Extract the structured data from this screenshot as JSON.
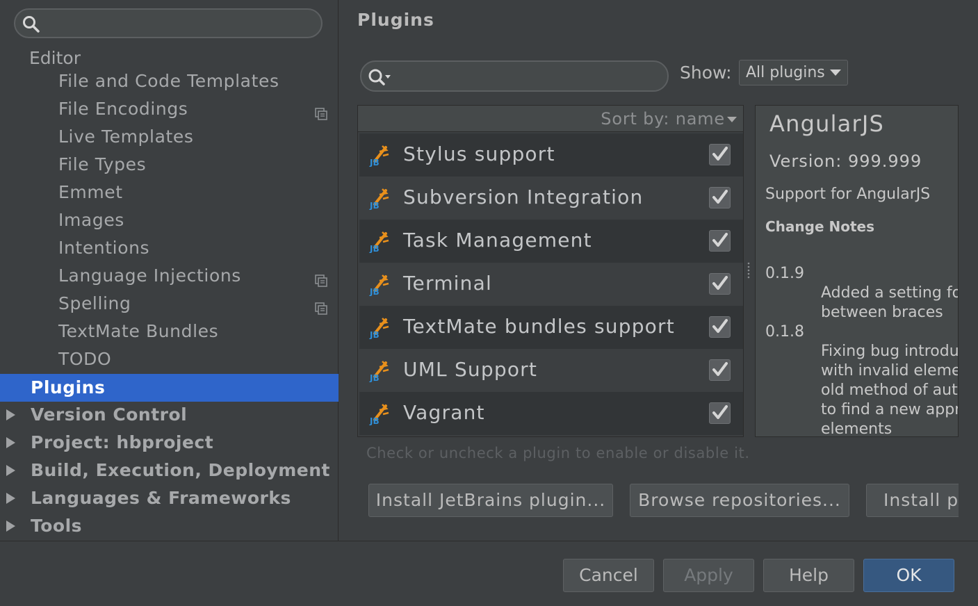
{
  "sidebar": {
    "search": {
      "icon": "search-icon",
      "value": ""
    },
    "items": [
      {
        "label": "Editor",
        "kind": "header"
      },
      {
        "label": "File and Code Templates",
        "kind": "child"
      },
      {
        "label": "File Encodings",
        "kind": "child",
        "icon": "project-scope-icon"
      },
      {
        "label": "Live Templates",
        "kind": "child"
      },
      {
        "label": "File Types",
        "kind": "child"
      },
      {
        "label": "Emmet",
        "kind": "child"
      },
      {
        "label": "Images",
        "kind": "child"
      },
      {
        "label": "Intentions",
        "kind": "child"
      },
      {
        "label": "Language Injections",
        "kind": "child",
        "icon": "project-scope-icon"
      },
      {
        "label": "Spelling",
        "kind": "child",
        "icon": "project-scope-icon"
      },
      {
        "label": "TextMate Bundles",
        "kind": "child"
      },
      {
        "label": "TODO",
        "kind": "child"
      },
      {
        "label": "Plugins",
        "kind": "top",
        "selected": true
      },
      {
        "label": "Version Control",
        "kind": "top",
        "expandable": true
      },
      {
        "label": "Project: hbproject",
        "kind": "top",
        "expandable": true
      },
      {
        "label": "Build, Execution, Deployment",
        "kind": "top",
        "expandable": true
      },
      {
        "label": "Languages & Frameworks",
        "kind": "top",
        "expandable": true
      },
      {
        "label": "Tools",
        "kind": "top",
        "expandable": true
      }
    ]
  },
  "main": {
    "title": "Plugins",
    "search": {
      "icon": "search-with-options-icon",
      "value": ""
    },
    "show_label": "Show:",
    "show_selected": "All plugins",
    "sort_label": "Sort by: name",
    "plugins": [
      {
        "name": "Stylus support",
        "enabled": true
      },
      {
        "name": "Subversion Integration",
        "enabled": true
      },
      {
        "name": "Task Management",
        "enabled": true
      },
      {
        "name": "Terminal",
        "enabled": true
      },
      {
        "name": "TextMate bundles support",
        "enabled": true
      },
      {
        "name": "UML Support",
        "enabled": true
      },
      {
        "name": "Vagrant",
        "enabled": true
      }
    ],
    "detail": {
      "name": "AngularJS",
      "version": "Version: 999.999",
      "description": "Support for AngularJS",
      "change_notes_heading": "Change Notes",
      "change_notes": [
        {
          "version": "0.1.9",
          "lines": [
            "Added a setting fo",
            "between braces"
          ]
        },
        {
          "version": "0.1.8",
          "lines": [
            "Fixing bug introdu",
            "with invalid elemer",
            "old method of autc",
            "to find a new appro",
            "elements"
          ]
        }
      ]
    },
    "hint": "Check or uncheck a plugin to enable or disable it.",
    "buttons": {
      "install_jetbrains": "Install JetBrains plugin...",
      "browse_repos": "Browse repositories...",
      "install_disk": "Install pl"
    }
  },
  "footer": {
    "cancel": "Cancel",
    "apply": "Apply",
    "help": "Help",
    "ok": "OK"
  },
  "colors": {
    "background": "#3c3f41",
    "selection": "#2f65ca",
    "primary_button": "#365880",
    "plugin_icon_orange": "#e8901c",
    "plugin_icon_blue": "#2f8fd8"
  }
}
